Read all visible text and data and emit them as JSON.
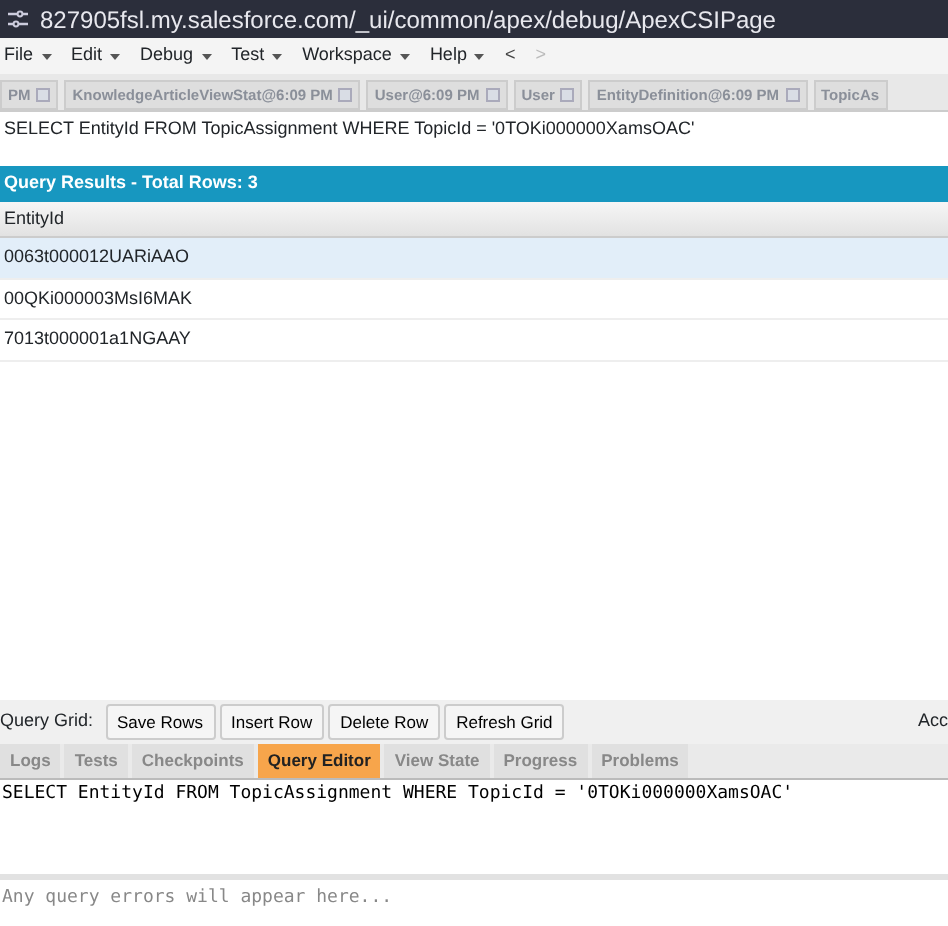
{
  "address_bar": {
    "url": "827905fsl.my.salesforce.com/_ui/common/apex/debug/ApexCSIPage"
  },
  "menu": [
    "File",
    "Edit",
    "Debug",
    "Test",
    "Workspace",
    "Help"
  ],
  "nav_buttons": [
    "<",
    ">"
  ],
  "editor_tabs": [
    {
      "label": "PM",
      "selected": false
    },
    {
      "label": "KnowledgeArticleViewStat@6:09 PM",
      "selected": false
    },
    {
      "label": "User@6:09 PM",
      "selected": false
    },
    {
      "label": "User",
      "selected": false
    },
    {
      "label": "EntityDefinition@6:09 PM",
      "selected": false
    },
    {
      "label": "TopicAs",
      "selected": false
    }
  ],
  "query_text": "SELECT EntityId FROM TopicAssignment WHERE TopicId = '0TOKi000000XamsOAC'",
  "results": {
    "title": "Query Results - Total Rows: 3",
    "columns": [
      "EntityId"
    ],
    "rows": [
      {
        "cells": [
          "0063t000012UARiAAO"
        ],
        "selected": true
      },
      {
        "cells": [
          "00QKi000003MsI6MAK"
        ],
        "selected": false
      },
      {
        "cells": [
          "7013t000001a1NGAAY"
        ],
        "selected": false
      }
    ]
  },
  "grid_toolbar": {
    "label": "Query Grid:",
    "buttons": [
      "Save Rows",
      "Insert Row",
      "Delete Row",
      "Refresh Grid"
    ],
    "right_text": "Acc"
  },
  "bottom_tabs": [
    {
      "label": "Logs",
      "selected": false
    },
    {
      "label": "Tests",
      "selected": false
    },
    {
      "label": "Checkpoints",
      "selected": false
    },
    {
      "label": "Query Editor",
      "selected": true
    },
    {
      "label": "View State",
      "selected": false
    },
    {
      "label": "Progress",
      "selected": false
    },
    {
      "label": "Problems",
      "selected": false
    }
  ],
  "query_editor": {
    "value": "SELECT EntityId FROM TopicAssignment WHERE TopicId = '0TOKi000000XamsOAC'"
  },
  "errors": {
    "placeholder": "Any query errors will appear here..."
  }
}
